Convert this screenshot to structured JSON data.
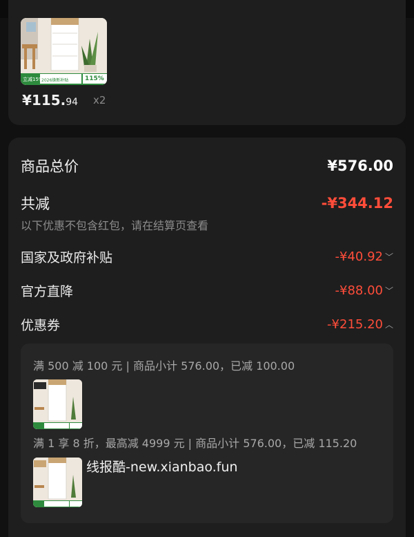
{
  "item": {
    "price_integer": "¥115.",
    "price_decimal": "94",
    "quantity": "x2",
    "badge_left": "立减15%",
    "badge_mid": "2026焕新补贴",
    "badge_right": "115%"
  },
  "summary": {
    "total_label": "商品总价",
    "total_value": "¥576.00",
    "discount_label": "共减",
    "discount_value": "-¥344.12",
    "note": "以下优惠不包含红包，请在结算页查看"
  },
  "discounts": [
    {
      "label": "国家及政府补贴",
      "value": "-¥40.92",
      "chevron": "chevron-down-icon"
    },
    {
      "label": "官方直降",
      "value": "-¥88.00",
      "chevron": "chevron-down-icon"
    },
    {
      "label": "优惠券",
      "value": "-¥215.20",
      "chevron": "chevron-up-icon"
    }
  ],
  "coupon_details": [
    {
      "rule": "满 500 减 100 元 | 商品小计 576.00，已减 100.00"
    },
    {
      "rule": "满 1 享 8 折，最高减 4999 元 | 商品小计 576.00，已减 115.20"
    }
  ],
  "watermark": "线报酷-new.xianbao.fun",
  "colors": {
    "accent_red": "#ff4d3a",
    "card_bg": "#1e1e1e",
    "page_bg": "#111111"
  }
}
